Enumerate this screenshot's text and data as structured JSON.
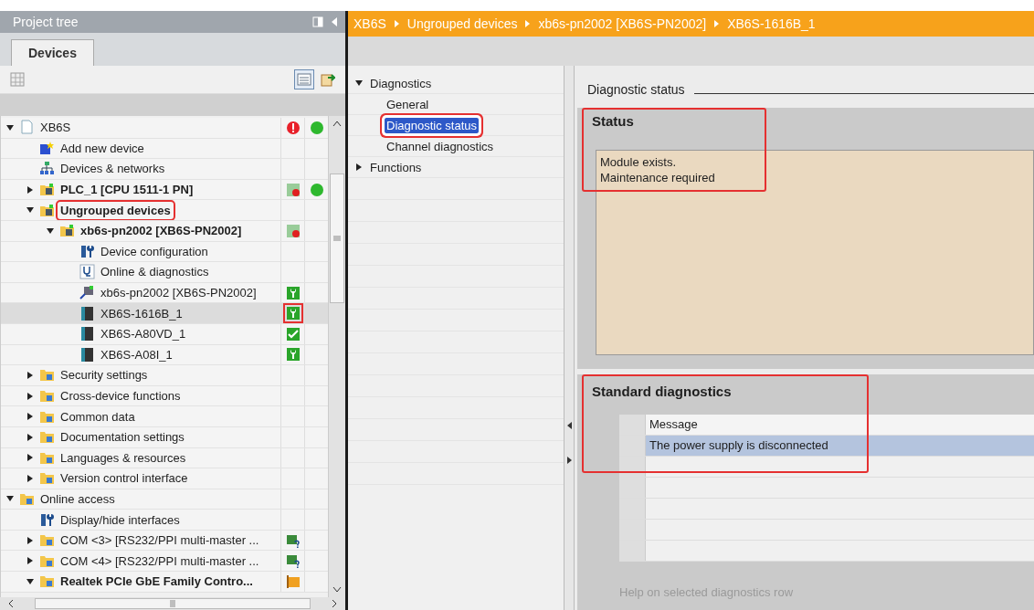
{
  "project_tree": {
    "title": "Project tree",
    "tabs": [
      {
        "label": "Devices",
        "selected": true
      }
    ],
    "items": [
      {
        "label": "XB6S",
        "kind": "document",
        "expanded": true,
        "status": [
          {
            "kind": "error"
          },
          {
            "kind": "online"
          }
        ],
        "children": [
          {
            "label": "Add new device",
            "kind": "add-device"
          },
          {
            "label": "Devices & networks",
            "kind": "network"
          },
          {
            "label": "PLC_1 [CPU 1511-1 PN]",
            "kind": "device-folder",
            "bold": true,
            "expanded": false,
            "status": [
              {
                "kind": "fault"
              },
              {
                "kind": "online"
              }
            ]
          },
          {
            "label": "Ungrouped devices",
            "kind": "device-folder",
            "bold": true,
            "expanded": true,
            "highlighted": true,
            "children": [
              {
                "label": "xb6s-pn2002 [XB6S-PN2002]",
                "kind": "device-folder",
                "bold": true,
                "expanded": true,
                "status": [
                  {
                    "kind": "fault"
                  }
                ],
                "children": [
                  {
                    "label": "Device configuration",
                    "kind": "config"
                  },
                  {
                    "label": "Online & diagnostics",
                    "kind": "diagnostics"
                  },
                  {
                    "label": "xb6s-pn2002 [XB6S-PN2002]",
                    "kind": "station",
                    "status": [
                      {
                        "kind": "maintenance"
                      }
                    ]
                  },
                  {
                    "label": "XB6S-1616B_1",
                    "kind": "module",
                    "selected": true,
                    "status": [
                      {
                        "kind": "maintenance",
                        "highlighted": true
                      }
                    ]
                  },
                  {
                    "label": "XB6S-A80VD_1",
                    "kind": "module",
                    "status": [
                      {
                        "kind": "ok"
                      }
                    ]
                  },
                  {
                    "label": "XB6S-A08I_1",
                    "kind": "module",
                    "status": [
                      {
                        "kind": "maintenance"
                      }
                    ]
                  }
                ]
              }
            ]
          },
          {
            "label": "Security settings",
            "kind": "folder",
            "expanded": false
          },
          {
            "label": "Cross-device functions",
            "kind": "folder",
            "expanded": false
          },
          {
            "label": "Common data",
            "kind": "folder",
            "expanded": false
          },
          {
            "label": "Documentation settings",
            "kind": "folder",
            "expanded": false
          },
          {
            "label": "Languages & resources",
            "kind": "folder",
            "expanded": false
          },
          {
            "label": "Version control interface",
            "kind": "folder",
            "expanded": false
          }
        ]
      },
      {
        "label": "Online access",
        "kind": "folder",
        "expanded": true,
        "children": [
          {
            "label": "Display/hide interfaces",
            "kind": "config"
          },
          {
            "label": "COM <3> [RS232/PPI multi-master ...",
            "kind": "folder",
            "expanded": false,
            "status": [
              {
                "kind": "unknown"
              }
            ]
          },
          {
            "label": "COM <4> [RS232/PPI multi-master ...",
            "kind": "folder",
            "expanded": false,
            "status": [
              {
                "kind": "unknown"
              }
            ]
          },
          {
            "label": "Realtek PCIe GbE Family Contro...",
            "kind": "folder",
            "bold": true,
            "expanded": true,
            "status": [
              {
                "kind": "adapter"
              }
            ]
          }
        ]
      }
    ]
  },
  "breadcrumb": [
    "XB6S",
    "Ungrouped devices",
    "xb6s-pn2002 [XB6S-PN2002]",
    "XB6S-1616B_1"
  ],
  "navigation": [
    {
      "label": "Diagnostics",
      "expanded": true,
      "children": [
        {
          "label": "General",
          "selected": false
        },
        {
          "label": "Diagnostic status",
          "selected": true,
          "highlighted": true
        },
        {
          "label": "Channel diagnostics",
          "selected": false
        }
      ]
    },
    {
      "label": "Functions",
      "expanded": false
    }
  ],
  "content": {
    "title": "Diagnostic status",
    "status": {
      "heading": "Status",
      "highlighted": true,
      "messages": [
        "Module exists.",
        "Maintenance required"
      ]
    },
    "standard_diagnostics": {
      "heading": "Standard diagnostics",
      "highlighted": true,
      "columns": [
        "Message"
      ],
      "rows": [
        {
          "message": "The power supply is disconnected",
          "selected": true
        }
      ],
      "help": "Help on selected diagnostics row"
    }
  }
}
